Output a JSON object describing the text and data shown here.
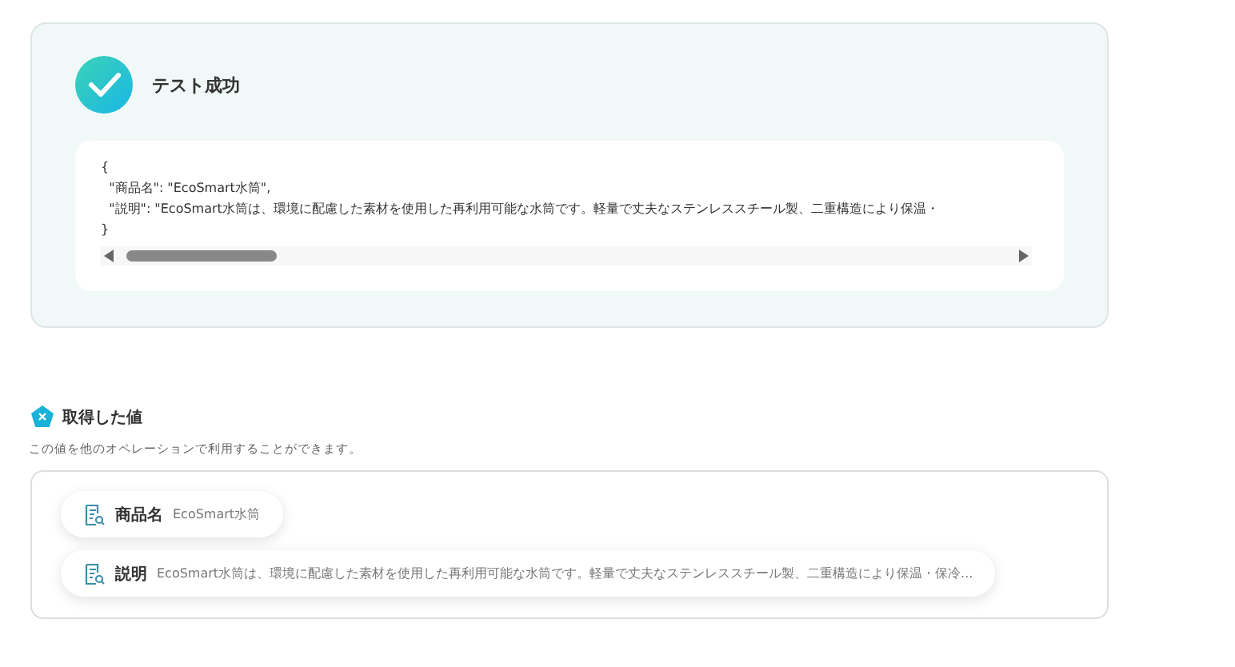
{
  "result": {
    "succeeded": true,
    "title": "テスト成功",
    "code_lines": [
      "{",
      "  \"商品名\": \"EcoSmart水筒\",",
      "  \"説明\": \"EcoSmart水筒は、環境に配慮した素材を使用した再利用可能な水筒です。軽量で丈夫なステンレススチール製、二重構造により保温・",
      "}"
    ]
  },
  "values_section": {
    "title": "取得した値",
    "description": "この値を他のオペレーションで利用することができます。",
    "items": [
      {
        "label": "商品名",
        "value": "EcoSmart水筒"
      },
      {
        "label": "説明",
        "value": "EcoSmart水筒は、環境に配慮した素材を使用した再利用可能な水筒です。軽量で丈夫なステンレススチール製、二重構造により保温・保冷..."
      }
    ]
  }
}
